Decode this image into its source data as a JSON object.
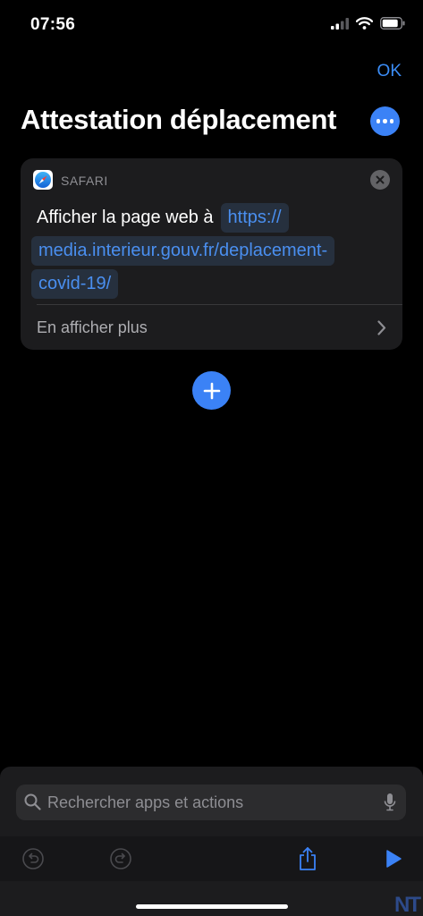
{
  "status_bar": {
    "time": "07:56"
  },
  "nav": {
    "ok_label": "OK"
  },
  "title": "Attestation déplacement",
  "action_card": {
    "app_name": "SAFARI",
    "action_text": "Afficher la page web à",
    "url_lines": [
      "https://",
      "media.interieur.gouv.fr/deplacement-",
      "covid-19/"
    ],
    "show_more_label": "En afficher plus"
  },
  "search": {
    "placeholder": "Rechercher apps et actions"
  },
  "watermark": "NT",
  "colors": {
    "accent": "#3b82f6",
    "link": "#4a8ff0",
    "background": "#000000",
    "card": "#1c1c1e"
  },
  "icons": [
    "signal-icon",
    "wifi-icon",
    "battery-icon",
    "more-icon",
    "safari-icon",
    "close-icon",
    "chevron-right-icon",
    "plus-icon",
    "search-icon",
    "mic-icon",
    "undo-icon",
    "redo-icon",
    "share-icon",
    "play-icon"
  ]
}
